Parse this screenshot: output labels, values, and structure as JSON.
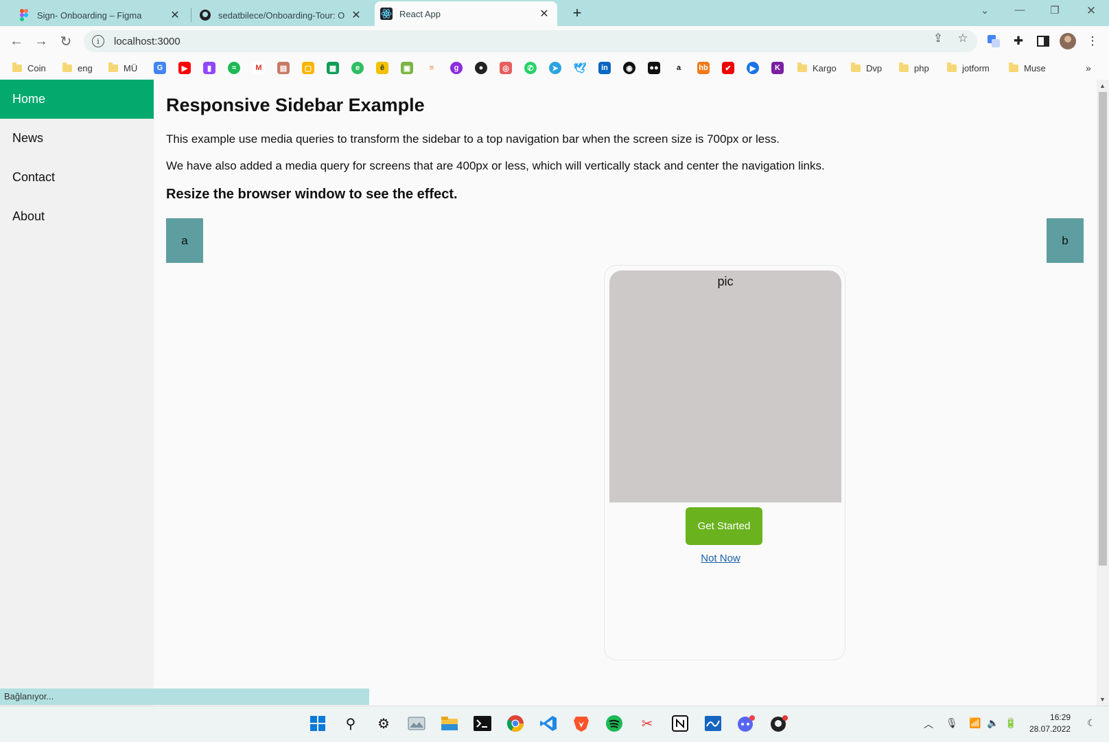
{
  "tabs": [
    {
      "label": "Sign- Onboarding – Figma",
      "icon": "figma-icon"
    },
    {
      "label": "sedatbilece/Onboarding-Tour: O",
      "icon": "github-icon"
    },
    {
      "label": "React App",
      "icon": "react-icon"
    }
  ],
  "address": {
    "url": "localhost:3000"
  },
  "bookmarks": {
    "folders": [
      "Coin",
      "eng",
      "MÜ",
      "Kargo",
      "Dvp",
      "php",
      "jotform",
      "Muse"
    ],
    "more": "»"
  },
  "sidebar": {
    "items": [
      {
        "label": "Home",
        "active": true
      },
      {
        "label": "News"
      },
      {
        "label": "Contact"
      },
      {
        "label": "About"
      }
    ]
  },
  "main": {
    "title": "Responsive Sidebar Example",
    "paragraph1": "This example use media queries to transform the sidebar to a top navigation bar when the screen size is 700px or less.",
    "paragraph2": "We have also added a media query for screens that are 400px or less, which will vertically stack and center the navigation links.",
    "subtitle": "Resize the browser window to see the effect.",
    "box_a": "a",
    "box_b": "b"
  },
  "card": {
    "pic_label": "pic",
    "primary_button": "Get Started",
    "secondary_link": "Not Now"
  },
  "status": {
    "text": "Bağlanıyor..."
  },
  "clock": {
    "time": "16:29",
    "date": "28.07.2022"
  },
  "colors": {
    "accent": "#04aa6d",
    "box": "#5f9ea0",
    "button": "#6ab21e",
    "tabstrip": "#b2e0e0"
  }
}
